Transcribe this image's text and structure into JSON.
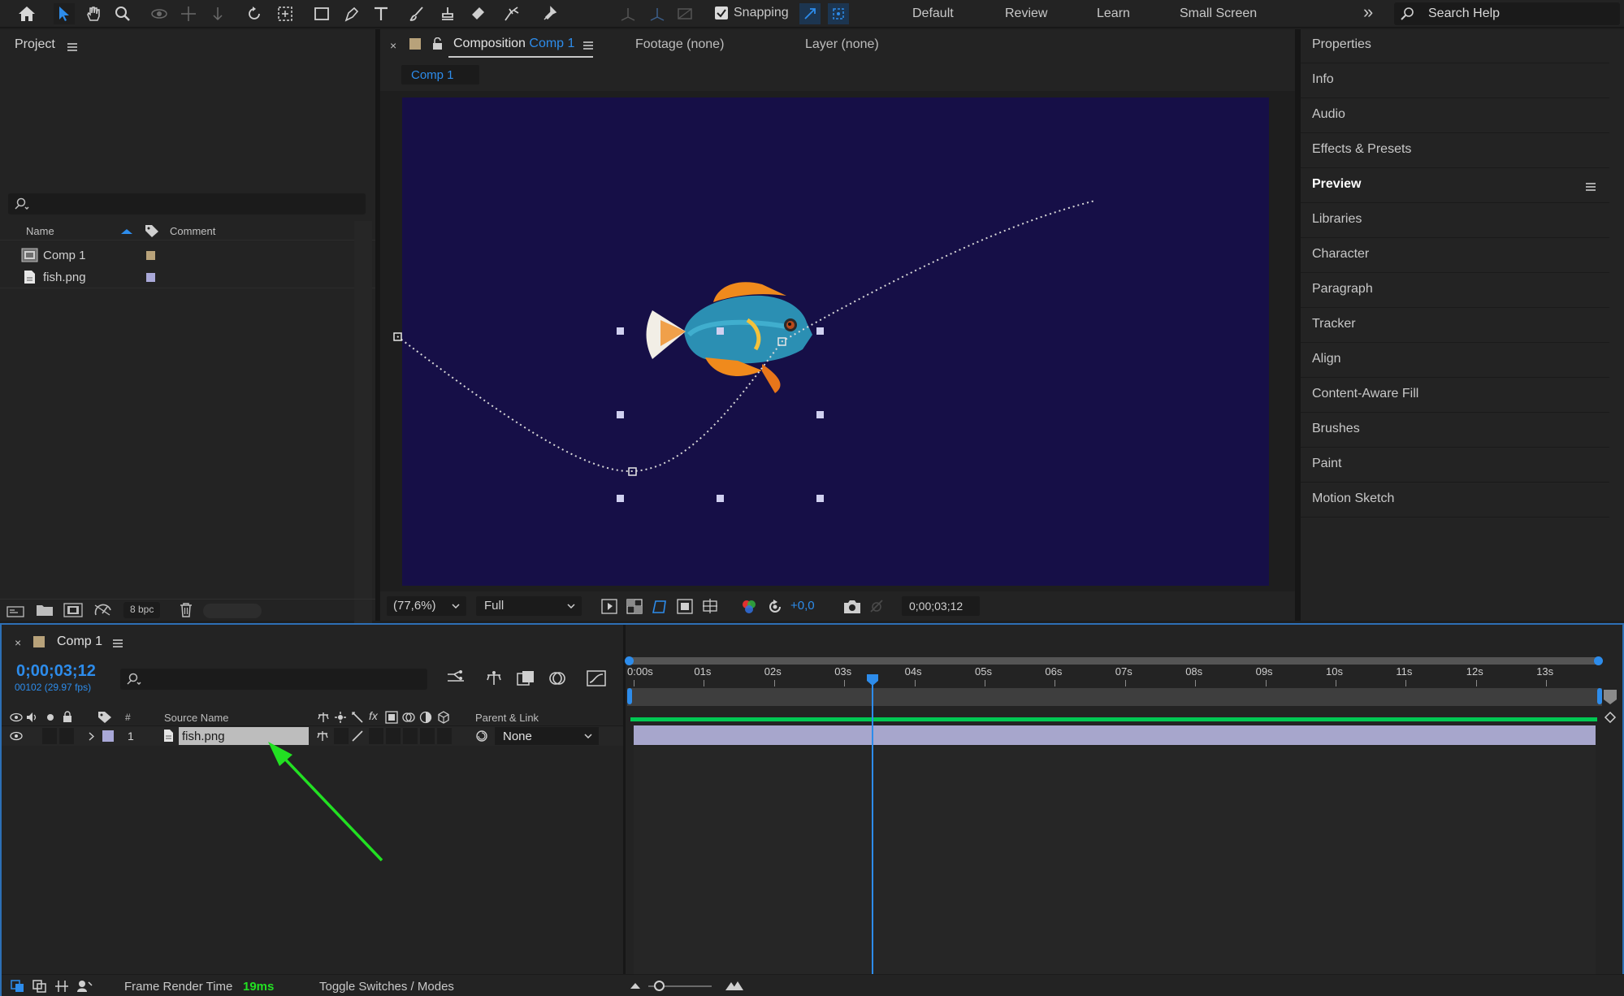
{
  "toolbar": {
    "snapping_label": "Snapping",
    "workspaces": [
      "Default",
      "Review",
      "Learn",
      "Small Screen"
    ],
    "more_glyph": "»",
    "search_placeholder": "Search Help"
  },
  "project_panel": {
    "title": "Project",
    "columns": {
      "name": "Name",
      "comment": "Comment"
    },
    "items": [
      {
        "name": "Comp 1",
        "type": "composition",
        "label_color": "#b8a27a"
      },
      {
        "name": "fish.png",
        "type": "footage",
        "label_color": "#a9a8d8"
      }
    ],
    "bpc_label": "8 bpc"
  },
  "viewer": {
    "tabs": {
      "composition_prefix": "Composition",
      "composition_name": "Comp 1",
      "footage": "Footage (none)",
      "layer": "Layer (none)"
    },
    "breadcrumb": "Comp 1",
    "canvas_color": "#160f47",
    "zoom": "(77,6%)",
    "resolution": "Full",
    "exposure": "+0,0",
    "timecode": "0;00;03;12"
  },
  "right_panels": [
    "Properties",
    "Info",
    "Audio",
    "Effects & Presets",
    "Preview",
    "Libraries",
    "Character",
    "Paragraph",
    "Tracker",
    "Align",
    "Content-Aware Fill",
    "Brushes",
    "Paint",
    "Motion Sketch"
  ],
  "timeline": {
    "comp_name": "Comp 1",
    "timecode": "0;00;03;12",
    "frame_info": "00102 (29.97 fps)",
    "columns": {
      "number": "#",
      "source_name": "Source Name",
      "parent_link": "Parent & Link"
    },
    "layers": [
      {
        "index": "1",
        "name": "fish.png",
        "parent": "None"
      }
    ],
    "ruler_labels": [
      "0:00s",
      "01s",
      "02s",
      "03s",
      "04s",
      "05s",
      "06s",
      "07s",
      "08s",
      "09s",
      "10s",
      "11s",
      "12s",
      "13s"
    ],
    "current_time_seconds": 3.4
  },
  "status_bar": {
    "frame_render_label": "Frame Render Time",
    "frame_render_value": "19ms",
    "toggle_label": "Toggle Switches / Modes"
  },
  "colors": {
    "accent_blue": "#2d8ceb",
    "annotation_arrow": "#22e022",
    "work_area_green": "#00c853"
  }
}
